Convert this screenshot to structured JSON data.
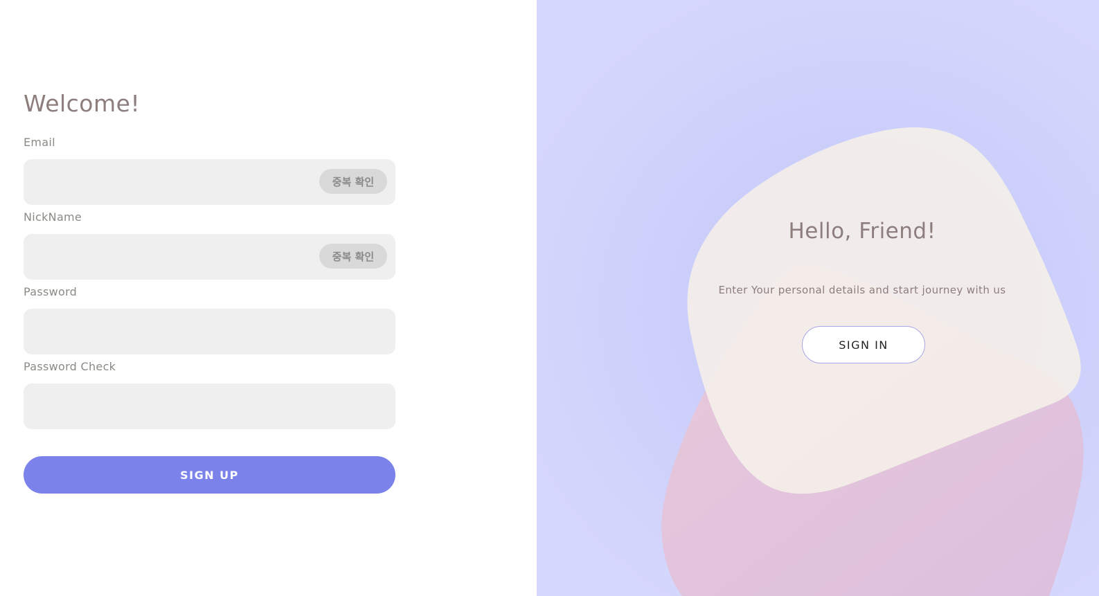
{
  "signup_form": {
    "title": "Welcome!",
    "fields": [
      {
        "label": "Email",
        "value": "",
        "placeholder": "",
        "check_button": "중복 확인"
      },
      {
        "label": "NickName",
        "value": "",
        "placeholder": "",
        "check_button": "중복 확인"
      },
      {
        "label": "Password",
        "value": "",
        "placeholder": ""
      },
      {
        "label": "Password Check",
        "value": "",
        "placeholder": ""
      }
    ],
    "submit_label": "SIGN UP"
  },
  "signin_panel": {
    "title": "Hello, Friend!",
    "subtitle": "Enter Your personal details and start journey with us",
    "button_label": "SIGN IN"
  },
  "colors": {
    "primary": "#7b82ea",
    "panel_background": "#cdd0fb",
    "heading_text": "#8d7d7d",
    "input_background": "#efefef",
    "blob_cream": "#f5efe9",
    "blob_pink": "#e2c5dc"
  }
}
